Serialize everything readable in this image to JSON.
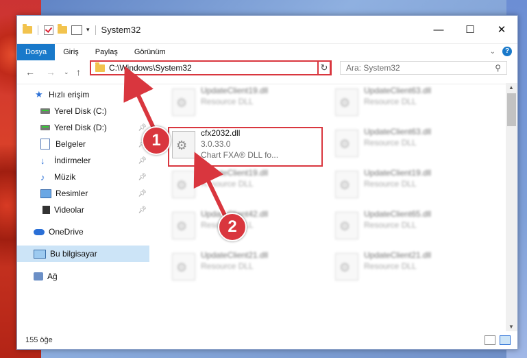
{
  "window": {
    "title": "System32"
  },
  "ribbon": {
    "tabs": [
      "Dosya",
      "Giriş",
      "Paylaş",
      "Görünüm"
    ]
  },
  "address": {
    "path": "C:\\Windows\\System32"
  },
  "search": {
    "placeholder": "Ara: System32"
  },
  "sidebar": {
    "items": [
      {
        "label": "Hızlı erişim",
        "icon": "star-icon"
      },
      {
        "label": "Yerel Disk (C:)",
        "icon": "drive-icon"
      },
      {
        "label": "Yerel Disk (D:)",
        "icon": "drive-icon"
      },
      {
        "label": "Belgeler",
        "icon": "documents-icon"
      },
      {
        "label": "İndirmeler",
        "icon": "downloads-icon"
      },
      {
        "label": "Müzik",
        "icon": "music-icon"
      },
      {
        "label": "Resimler",
        "icon": "pictures-icon"
      },
      {
        "label": "Videolar",
        "icon": "videos-icon"
      },
      {
        "label": "OneDrive",
        "icon": "cloud-icon"
      },
      {
        "label": "Bu bilgisayar",
        "icon": "computer-icon"
      },
      {
        "label": "Ağ",
        "icon": "network-icon"
      }
    ]
  },
  "files": [
    {
      "name": "UpdateClient19.dll",
      "type": "Resource DLL"
    },
    {
      "name": "UpdateClient63.dll",
      "type": "Resource DLL"
    },
    {
      "name": "cfx2032.dll",
      "version": "3.0.33.0",
      "desc": "Chart FXA® DLL fo..."
    },
    {
      "name": "UpdateClient63.dll",
      "type": "Resource DLL"
    },
    {
      "name": "UpdateClient19.dll",
      "type": "Resource DLL"
    },
    {
      "name": "UpdateClient19.dll",
      "type": "Resource DLL"
    },
    {
      "name": "UpdateClient42.dll",
      "type": "Resource DLL"
    },
    {
      "name": "UpdateClient65.dll",
      "type": "Resource DLL"
    },
    {
      "name": "UpdateClient21.dll",
      "type": "Resource DLL"
    },
    {
      "name": "UpdateClient21.dll",
      "type": "Resource DLL"
    }
  ],
  "status": {
    "count": "155 öğe"
  },
  "callouts": [
    "1",
    "2"
  ],
  "colors": {
    "accent": "#1979ca",
    "highlight": "#d9363e"
  }
}
